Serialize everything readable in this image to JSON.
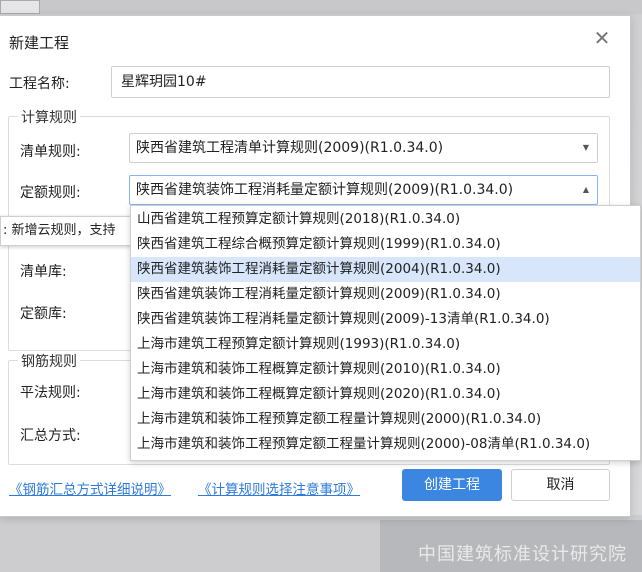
{
  "background": {
    "watermark": "中国建筑标准设计研究院"
  },
  "dialog": {
    "title": "新建工程",
    "close_glyph": "✕",
    "project_name_label": "工程名称:",
    "project_name_value": "星辉玥园10#",
    "calc_rules": {
      "group_title": "计算规则",
      "list_rule_label": "清单规则:",
      "list_rule_value": "陕西省建筑工程清单计算规则(2009)(R1.0.34.0)",
      "quota_rule_label": "定额规则:",
      "quota_rule_value": "陕西省建筑装饰工程消耗量定额计算规则(2009)(R1.0.34.0)"
    },
    "tooltip_text": ": 新增云规则，支持",
    "library": {
      "list_lib_label": "清单库:",
      "quota_lib_label": "定额库:"
    },
    "rebar_rules": {
      "group_title": "钢筋规则",
      "flat_rule_label": "平法规则:",
      "summary_label": "汇总方式:"
    },
    "dropdown_options": [
      "山西省建筑工程预算定额计算规则(2018)(R1.0.34.0)",
      "陕西省建筑工程综合概预算定额计算规则(1999)(R1.0.34.0)",
      "陕西省建筑装饰工程消耗量定额计算规则(2004)(R1.0.34.0)",
      "陕西省建筑装饰工程消耗量定额计算规则(2009)(R1.0.34.0)",
      "陕西省建筑装饰工程消耗量定额计算规则(2009)-13清单(R1.0.34.0)",
      "上海市建筑工程预算定额计算规则(1993)(R1.0.34.0)",
      "上海市建筑和装饰工程概算定额计算规则(2010)(R1.0.34.0)",
      "上海市建筑和装饰工程概算定额计算规则(2020)(R1.0.34.0)",
      "上海市建筑和装饰工程预算定额工程量计算规则(2000)(R1.0.34.0)",
      "上海市建筑和装饰工程预算定额工程量计算规则(2000)-08清单(R1.0.34.0)"
    ],
    "highlighted_option_index": 2,
    "links": {
      "rebar_summary_help": "《钢筋汇总方式详细说明》",
      "calc_rule_notes": "《计算规则选择注意事项》"
    },
    "buttons": {
      "create": "创建工程",
      "cancel": "取消"
    }
  },
  "colors": {
    "accent": "#3a86e0",
    "link": "#2f7bd9",
    "highlight": "#d7e6fb"
  }
}
